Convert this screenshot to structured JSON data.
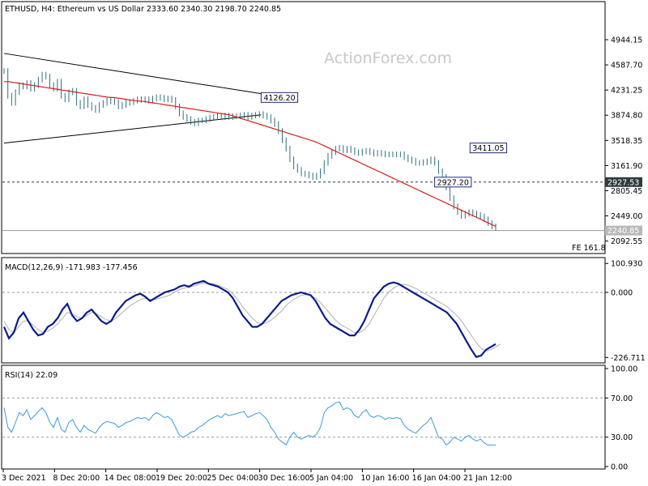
{
  "header": {
    "text": "ETHUSD, H4:  Ethereum vs US Dollar  2333.60 2340.30 2198.70 2240.85"
  },
  "watermark": "ActionForex.com",
  "colors": {
    "price": "#2b6f80",
    "ma": "#d61e1e",
    "macd": "#0a1c8c",
    "signal": "#b0b0b0",
    "rsi": "#3a9ad9",
    "levelLine": "#333333"
  },
  "chart_data": [
    {
      "type": "line",
      "name": "price",
      "yticks": [
        "4944.15",
        "4587.70",
        "4231.25",
        "3874.80",
        "3518.35",
        "3161.90",
        "2805.45",
        "2449.00",
        "2092.55"
      ],
      "ylim": [
        1950,
        5300
      ],
      "xticks": [
        "3 Dec 2021",
        "8 Dec 20:00",
        "14 Dec 08:00",
        "19 Dec 20:00",
        "25 Dec 04:00",
        "30 Dec 16:00",
        "5 Jan 04:00",
        "10 Jan 16:00",
        "16 Jan 04:00",
        "21 Jan 12:00"
      ],
      "x": [
        0,
        2,
        4,
        6,
        8,
        10,
        12,
        14,
        16,
        18,
        20,
        22,
        24,
        26,
        28,
        30,
        32,
        34,
        36,
        38,
        40,
        42,
        44,
        46,
        48,
        50,
        52,
        54,
        56,
        58,
        60,
        62,
        64,
        66,
        68,
        70,
        72,
        74,
        76,
        78,
        80,
        82,
        84,
        86,
        88,
        90,
        92,
        94,
        96,
        98,
        100,
        102,
        104,
        106,
        108,
        110,
        112,
        114,
        116,
        118,
        120,
        122,
        124,
        126,
        128,
        130,
        132,
        134,
        136,
        138,
        140,
        142,
        144,
        146,
        148,
        150,
        152,
        154,
        156,
        158,
        160,
        162,
        164,
        166,
        168,
        170,
        172,
        174,
        176,
        178,
        180,
        182,
        184,
        186,
        188,
        190,
        192,
        194,
        196,
        198,
        200,
        202,
        204,
        206,
        208,
        210,
        212,
        214,
        216,
        218,
        220,
        222,
        224,
        226,
        228,
        230,
        232,
        234,
        236,
        238,
        240,
        242,
        244,
        246,
        248,
        250,
        252,
        254,
        256,
        258,
        260,
        262,
        264,
        266,
        268,
        270,
        272,
        274,
        276,
        278,
        280,
        282,
        284,
        286,
        288,
        290,
        292,
        294,
        296,
        298,
        300,
        302,
        304,
        306
      ],
      "close": [
        4500,
        4150,
        4050,
        4200,
        4300,
        4280,
        4330,
        4250,
        4300,
        4380,
        4450,
        4420,
        4300,
        4250,
        4350,
        4150,
        4100,
        4200,
        4220,
        4050,
        4000,
        4100,
        4020,
        3980,
        3950,
        4020,
        4050,
        4080,
        4070,
        4060,
        4000,
        4020,
        4050,
        4060,
        4080,
        4100,
        4090,
        4100,
        4080,
        4110,
        4130,
        4120,
        4100,
        4110,
        4090,
        4000,
        3900,
        3850,
        3820,
        3780,
        3760,
        3800,
        3800,
        3820,
        3840,
        3850,
        3860,
        3850,
        3870,
        3850,
        3860,
        3860,
        3870,
        3880,
        3850,
        3870,
        3880,
        3890,
        3870,
        3850,
        3800,
        3750,
        3650,
        3520,
        3400,
        3250,
        3150,
        3100,
        3050,
        3040,
        3020,
        3000,
        3020,
        3080,
        3200,
        3300,
        3350,
        3400,
        3411,
        3380,
        3400,
        3380,
        3350,
        3340,
        3360,
        3370,
        3350,
        3330,
        3340,
        3330,
        3320,
        3320,
        3320,
        3320,
        3320,
        3280,
        3250,
        3230,
        3200,
        3200,
        3210,
        3220,
        3250,
        3200,
        3080,
        3000,
        2850,
        2700,
        2580,
        2500,
        2450,
        2480,
        2500,
        2480,
        2460,
        2440,
        2400,
        2350,
        2300,
        2280
      ],
      "ma": [
        4350,
        4350,
        4340,
        4330,
        4320,
        4310,
        4300,
        4290,
        4280,
        4270,
        4260,
        4250,
        4240,
        4230,
        4220,
        4210,
        4200,
        4190,
        4180,
        4170,
        4160,
        4150,
        4140,
        4130,
        4125,
        4120,
        4110,
        4100,
        4090,
        4080,
        4075,
        4070,
        4060,
        4050,
        4040,
        4030,
        4020,
        4010,
        4000,
        3990,
        3980,
        3970,
        3960,
        3950,
        3940,
        3930,
        3920,
        3910,
        3900,
        3890,
        3880,
        3860,
        3840,
        3820,
        3800,
        3780,
        3760,
        3740,
        3720,
        3700,
        3680,
        3660,
        3640,
        3620,
        3600,
        3580,
        3560,
        3540,
        3520,
        3500,
        3470,
        3440,
        3410,
        3380,
        3350,
        3320,
        3290,
        3260,
        3230,
        3200,
        3170,
        3140,
        3110,
        3080,
        3050,
        3020,
        2990,
        2960,
        2930,
        2900,
        2870,
        2840,
        2810,
        2780,
        2750,
        2720,
        2690,
        2660,
        2630,
        2600,
        2570,
        2540,
        2510,
        2480,
        2450,
        2420,
        2390,
        2360,
        2330,
        2300
      ],
      "triangle_upper": [
        [
          0,
          4750
        ],
        [
          160,
          4180
        ]
      ],
      "triangle_lower": [
        [
          0,
          3480
        ],
        [
          160,
          3880
        ]
      ],
      "hlines": [
        {
          "value": 2927.53,
          "label": "2927.53",
          "style": "dotted"
        },
        {
          "value": 2240.85,
          "label": "2240.85",
          "style": "solid"
        }
      ],
      "annotations": [
        {
          "text": "4126.20",
          "x": 160,
          "y": 4126.2
        },
        {
          "text": "3411.05",
          "x": 290,
          "y": 3411.05
        },
        {
          "text": "2927.20",
          "x": 268,
          "y": 2927.2
        }
      ],
      "note": "FE 161.8"
    },
    {
      "type": "line",
      "name": "MACD",
      "label": "MACD(12,26,9) -171.983 -177.456",
      "yticks": [
        "100.930",
        "0.000",
        "-226.711"
      ],
      "ylim": [
        -240,
        110
      ],
      "macd": [
        -120,
        -160,
        -140,
        -90,
        -70,
        -100,
        -130,
        -150,
        -145,
        -120,
        -110,
        -90,
        -60,
        -40,
        -80,
        -100,
        -90,
        -70,
        -60,
        -80,
        -100,
        -110,
        -100,
        -70,
        -50,
        -30,
        -20,
        -10,
        -5,
        -15,
        -30,
        -20,
        -10,
        0,
        5,
        10,
        20,
        25,
        20,
        30,
        35,
        40,
        30,
        25,
        20,
        10,
        0,
        -20,
        -50,
        -80,
        -100,
        -120,
        -120,
        -110,
        -90,
        -70,
        -50,
        -30,
        -20,
        -10,
        -5,
        0,
        -5,
        -10,
        -30,
        -60,
        -90,
        -110,
        -120,
        -130,
        -140,
        -150,
        -150,
        -130,
        -100,
        -60,
        -20,
        0,
        20,
        30,
        35,
        30,
        20,
        10,
        0,
        -10,
        -20,
        -30,
        -40,
        -50,
        -60,
        -70,
        -90,
        -110,
        -140,
        -170,
        -200,
        -225,
        -220,
        -200,
        -190,
        -180
      ],
      "signal": [
        -100,
        -130,
        -140,
        -120,
        -100,
        -100,
        -115,
        -130,
        -140,
        -135,
        -125,
        -110,
        -90,
        -70,
        -75,
        -85,
        -90,
        -80,
        -70,
        -75,
        -85,
        -95,
        -100,
        -90,
        -75,
        -60,
        -45,
        -35,
        -25,
        -20,
        -25,
        -25,
        -20,
        -15,
        -10,
        0,
        10,
        15,
        18,
        22,
        28,
        32,
        32,
        30,
        25,
        18,
        10,
        -5,
        -25,
        -50,
        -70,
        -90,
        -105,
        -110,
        -105,
        -95,
        -80,
        -65,
        -45,
        -30,
        -20,
        -10,
        -8,
        -10,
        -20,
        -35,
        -55,
        -75,
        -95,
        -110,
        -120,
        -130,
        -140,
        -140,
        -130,
        -110,
        -80,
        -50,
        -20,
        0,
        15,
        25,
        28,
        25,
        18,
        10,
        0,
        -10,
        -20,
        -30,
        -40,
        -50,
        -65,
        -80,
        -100,
        -125,
        -150,
        -175,
        -195,
        -205,
        -200,
        -190,
        -180
      ]
    },
    {
      "type": "line",
      "name": "RSI",
      "label": "RSI(14) 22.09",
      "yticks": [
        "100.00",
        "70.00",
        "30.00",
        "0.00"
      ],
      "ylim": [
        0,
        100
      ],
      "levels": [
        70,
        30
      ],
      "rsi": [
        60,
        40,
        35,
        45,
        55,
        52,
        58,
        48,
        52,
        56,
        60,
        55,
        45,
        40,
        50,
        38,
        35,
        45,
        48,
        40,
        35,
        42,
        38,
        36,
        34,
        40,
        44,
        46,
        45,
        44,
        40,
        42,
        45,
        46,
        48,
        50,
        49,
        50,
        47,
        52,
        55,
        53,
        50,
        51,
        48,
        40,
        32,
        30,
        32,
        35,
        36,
        40,
        42,
        45,
        48,
        50,
        52,
        50,
        54,
        52,
        53,
        54,
        55,
        56,
        50,
        52,
        54,
        55,
        52,
        48,
        40,
        35,
        28,
        25,
        22,
        30,
        35,
        30,
        28,
        30,
        32,
        30,
        33,
        40,
        55,
        60,
        62,
        65,
        66,
        58,
        60,
        58,
        52,
        50,
        55,
        58,
        52,
        50,
        52,
        51,
        48,
        50,
        49,
        50,
        49,
        42,
        38,
        36,
        34,
        38,
        42,
        45,
        50,
        40,
        30,
        28,
        22,
        25,
        30,
        28,
        26,
        30,
        32,
        28,
        26,
        28,
        24,
        22,
        22,
        22
      ]
    }
  ]
}
